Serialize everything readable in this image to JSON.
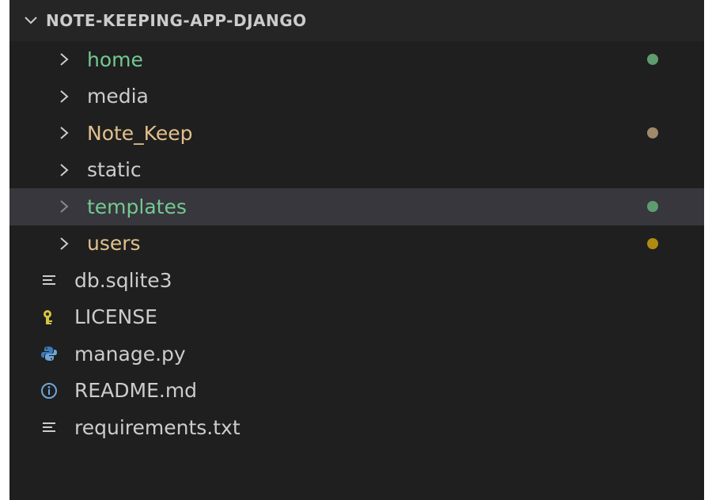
{
  "explorer": {
    "title": "NOTE-KEEPING-APP-DJANGO",
    "folders": [
      {
        "label": "home",
        "color": "#73c991",
        "dot": "#5e9c6f",
        "selected": false
      },
      {
        "label": "media",
        "color": "#cccccc",
        "dot": null,
        "selected": false
      },
      {
        "label": "Note_Keep",
        "color": "#e2c08d",
        "dot": "#a08a6a",
        "selected": false
      },
      {
        "label": "static",
        "color": "#cccccc",
        "dot": null,
        "selected": false
      },
      {
        "label": "templates",
        "color": "#73c991",
        "dot": "#5e9c6f",
        "selected": true
      },
      {
        "label": "users",
        "color": "#e2c08d",
        "dot": "#b08b14",
        "selected": false
      }
    ],
    "files": [
      {
        "label": "db.sqlite3",
        "icon": "lines-file-icon"
      },
      {
        "label": "LICENSE",
        "icon": "license-key-icon"
      },
      {
        "label": "manage.py",
        "icon": "python-icon"
      },
      {
        "label": "README.md",
        "icon": "info-icon"
      },
      {
        "label": "requirements.txt",
        "icon": "lines-file-icon"
      }
    ],
    "file_label_color": "#cccccc"
  }
}
